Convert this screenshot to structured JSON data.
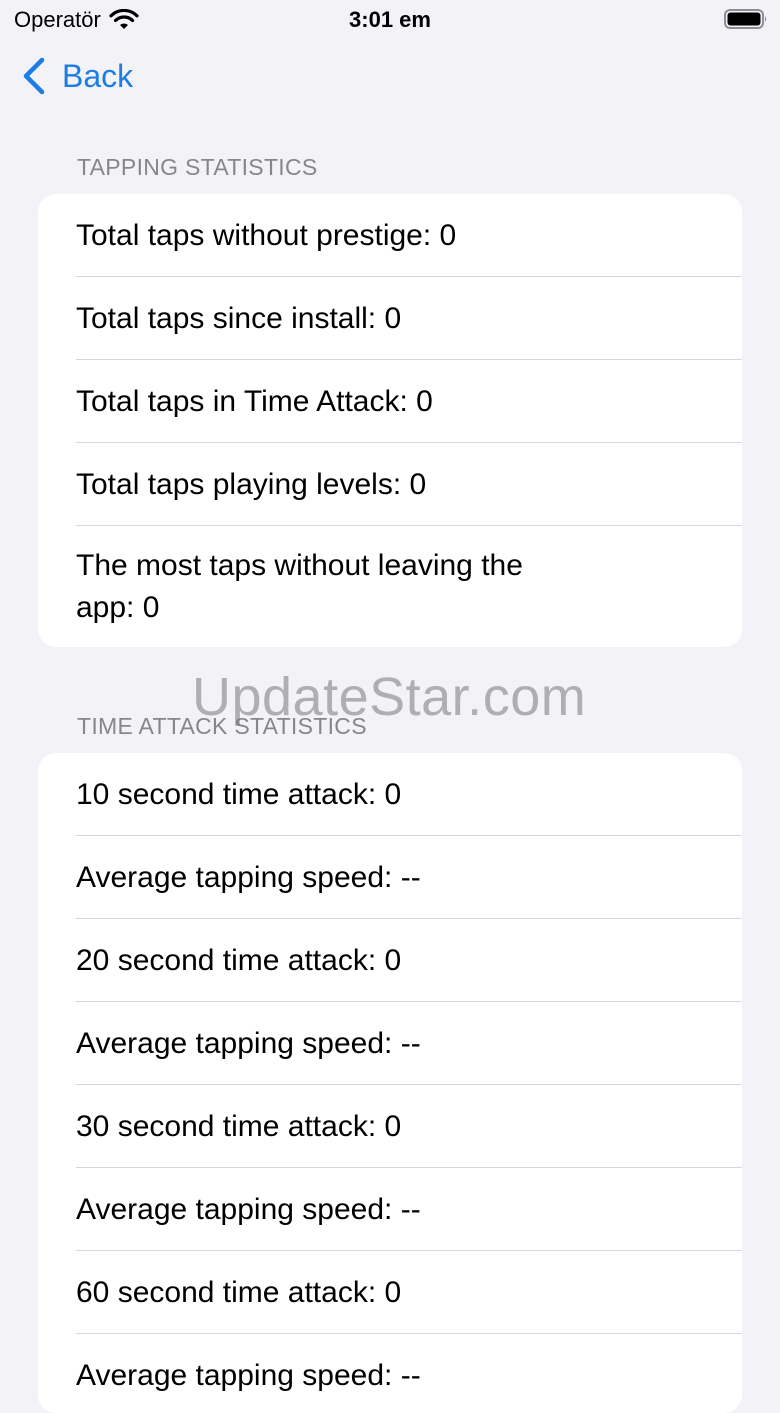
{
  "status_bar": {
    "carrier": "Operatör",
    "time": "3:01 em"
  },
  "nav": {
    "back_label": "Back"
  },
  "tapping": {
    "header": "TAPPING STATISTICS",
    "rows": [
      "Total taps without prestige: 0",
      "Total taps since install: 0",
      "Total taps in Time Attack: 0",
      "Total taps playing levels: 0",
      "The most taps without leaving the app: 0"
    ]
  },
  "time_attack": {
    "header": "TIME ATTACK STATISTICS",
    "rows": [
      "10 second time attack: 0",
      "Average tapping speed: --",
      "20 second time attack: 0",
      "Average tapping speed: --",
      "30 second time attack: 0",
      "Average tapping speed: --",
      "60 second time attack: 0",
      "Average tapping speed: --"
    ]
  },
  "watermark": "UpdateStar.com",
  "colors": {
    "accent": "#1a7ee6",
    "background": "#f2f2f7",
    "header_text": "#86868b"
  }
}
